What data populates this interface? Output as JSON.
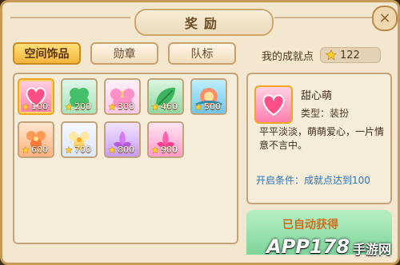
{
  "window": {
    "title": "奖励"
  },
  "tabs": [
    {
      "label": "空间饰品",
      "active": true
    },
    {
      "label": "勋章",
      "active": false
    },
    {
      "label": "队标",
      "active": false
    }
  ],
  "points": {
    "label": "我的成就点",
    "value": "122"
  },
  "items": [
    {
      "cost": "100",
      "theme": "heart",
      "selected": true
    },
    {
      "cost": "200",
      "theme": "clover"
    },
    {
      "cost": "300",
      "theme": "flower-pink"
    },
    {
      "cost": "460",
      "theme": "leaf"
    },
    {
      "cost": "500",
      "theme": "teal-bloom"
    },
    {
      "cost": "600",
      "theme": "orange-blossom"
    },
    {
      "cost": "700",
      "theme": "yellow-blossom"
    },
    {
      "cost": "800",
      "theme": "purple-lotus"
    },
    {
      "cost": "900",
      "theme": "pink-lotus"
    }
  ],
  "detail": {
    "name": "甜心萌",
    "type": "类型：装扮",
    "description": "平平淡淡，萌萌爱心，一片情意不言中。",
    "condition": "开启条件：成就点达到100"
  },
  "bottom": {
    "text": "已自动获得"
  },
  "watermark": {
    "main": "APP178",
    "sub": "手游网"
  },
  "colors": {
    "accent": "#f2b43c",
    "panel": "#f6ecda",
    "border": "#c7a478",
    "link_blue": "#2a75b8"
  }
}
